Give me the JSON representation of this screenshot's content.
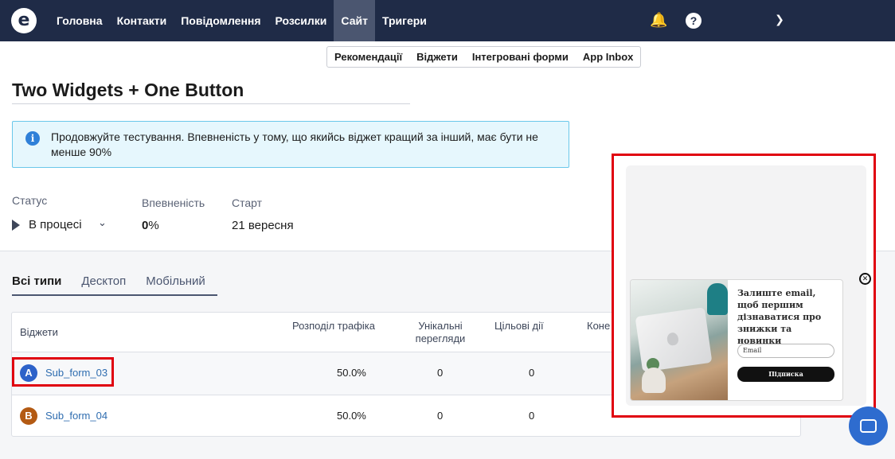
{
  "nav": {
    "items": [
      {
        "label": "Головна"
      },
      {
        "label": "Контакти"
      },
      {
        "label": "Повідомлення"
      },
      {
        "label": "Розсилки"
      },
      {
        "label": "Сайт"
      },
      {
        "label": "Тригери"
      }
    ],
    "active_index": 4,
    "icons": [
      "bell-icon",
      "help-icon",
      "chevron-down-icon"
    ]
  },
  "subnav": {
    "items": [
      {
        "label": "Рекомендації"
      },
      {
        "label": "Віджети"
      },
      {
        "label": "Інтегровані форми"
      },
      {
        "label": "App Inbox"
      }
    ]
  },
  "page": {
    "title": "Two Widgets + One Button"
  },
  "info": {
    "text": "Продовжуйте тестування. Впевненість у тому, що якийсь віджет кращий за інший, має бути не менше 90%",
    "accent": "#6ac7ea"
  },
  "stats": {
    "status_label": "Статус",
    "status_value": "В процесі",
    "confidence_label": "Впевненість",
    "confidence_number": "0",
    "confidence_unit": "%",
    "start_label": "Старт",
    "start_value": "21 вересня"
  },
  "tabs": [
    {
      "label": "Всі типи"
    },
    {
      "label": "Десктоп"
    },
    {
      "label": "Мобільний"
    }
  ],
  "table": {
    "columns": {
      "widgets": "Віджети",
      "traffic": "Розподіл трафіка",
      "unique_line1": "Унікальні",
      "unique_line2": "перегляди",
      "goals": "Цільові дії",
      "conv": "Коне"
    },
    "rows": [
      {
        "badge": "A",
        "name": "Sub_form_03",
        "traffic": "50.0%",
        "unique": "0",
        "goals": "0"
      },
      {
        "badge": "B",
        "name": "Sub_form_04",
        "traffic": "50.0%",
        "unique": "0",
        "goals": "0"
      }
    ]
  },
  "preview": {
    "title": "Залиште email, щоб першим дізнаватися про знижки та новинки",
    "input_placeholder": "Email",
    "button_label": "Підписка"
  },
  "colors": {
    "nav_bg": "#1f2b47",
    "highlight": "#e0000f",
    "link": "#2f6db0"
  }
}
